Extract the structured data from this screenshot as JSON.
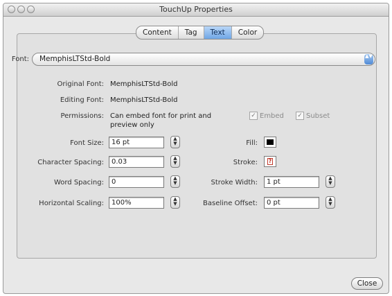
{
  "window": {
    "title": "TouchUp Properties"
  },
  "tabs": [
    "Content",
    "Tag",
    "Text",
    "Color"
  ],
  "active_tab": "Text",
  "font": {
    "label": "Font:",
    "value": "MemphisLTStd-Bold"
  },
  "info": {
    "original_font_label": "Original Font:",
    "original_font_value": "MemphisLTStd-Bold",
    "editing_font_label": "Editing Font:",
    "editing_font_value": "MemphisLTStd-Bold",
    "permissions_label": "Permissions:",
    "permissions_line1": "Can embed font for print and",
    "permissions_line2": "preview only",
    "embed_label": "Embed",
    "subset_label": "Subset"
  },
  "left_fields": [
    {
      "label": "Font Size:",
      "value": "16 pt"
    },
    {
      "label": "Character Spacing:",
      "value": "0.03"
    },
    {
      "label": "Word Spacing:",
      "value": "0"
    },
    {
      "label": "Horizontal Scaling:",
      "value": "100%"
    }
  ],
  "right_fields": {
    "fill_label": "Fill:",
    "stroke_label": "Stroke:",
    "stroke_width_label": "Stroke Width:",
    "stroke_width_value": "1 pt",
    "baseline_offset_label": "Baseline Offset:",
    "baseline_offset_value": "0 pt"
  },
  "colors": {
    "fill": "#000000",
    "stroke_none": "#c0392b",
    "accent": "#5b95dc"
  },
  "buttons": {
    "close": "Close"
  }
}
